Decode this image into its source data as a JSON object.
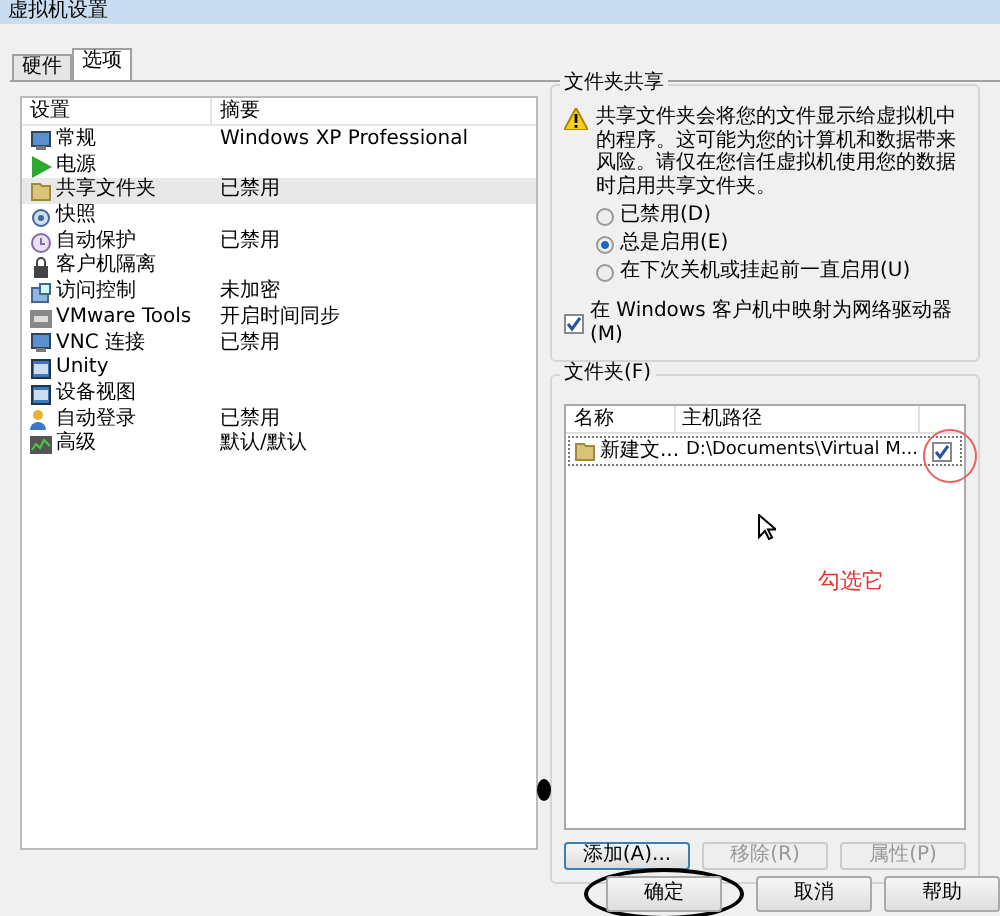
{
  "window": {
    "title": "虚拟机设置"
  },
  "tabs": [
    {
      "label": "硬件",
      "selected": false
    },
    {
      "label": "选项",
      "selected": true
    }
  ],
  "settings": {
    "columns": [
      "设置",
      "摘要"
    ],
    "rows": [
      {
        "name": "常规",
        "summary": "Windows XP Professional",
        "selected": false
      },
      {
        "name": "电源",
        "selected": false
      },
      {
        "name": "共享文件夹",
        "summary": "已禁用",
        "selected": true
      },
      {
        "name": "快照",
        "selected": false
      },
      {
        "name": "自动保护",
        "summary": "已禁用",
        "selected": false
      },
      {
        "name": "客户机隔离",
        "selected": false
      },
      {
        "name": "访问控制",
        "summary": "未加密",
        "selected": false
      },
      {
        "name": "VMware Tools",
        "summary": "开启时间同步",
        "selected": false
      },
      {
        "name": "VNC 连接",
        "summary": "已禁用",
        "selected": false
      },
      {
        "name": "Unity",
        "selected": false
      },
      {
        "name": "设备视图",
        "selected": false
      },
      {
        "name": "自动登录",
        "summary": "已禁用",
        "selected": false
      },
      {
        "name": "高级",
        "summary": "默认/默认",
        "selected": false
      }
    ]
  },
  "sharing": {
    "title": "文件夹共享",
    "warning": "共享文件夹会将您的文件显示给虚拟机中的程序。这可能为您的计算机和数据带来风险。请仅在您信任虚拟机使用您的数据时启用共享文件夹。",
    "options": [
      {
        "label": "已禁用(D)",
        "selected": false
      },
      {
        "label": "总是启用(E)",
        "selected": true
      },
      {
        "label": "在下次关机或挂起前一直启用(U)",
        "selected": false
      }
    ],
    "map_drive": {
      "label": "在 Windows 客户机中映射为网络驱动器(M)",
      "checked": true
    }
  },
  "folders": {
    "title": "文件夹(F)",
    "columns": [
      "名称",
      "主机路径"
    ],
    "rows": [
      {
        "name": "新建文...",
        "path": "D:\\Documents\\Virtual M...",
        "checked": true
      }
    ],
    "buttons": [
      {
        "label": "添加(A)...",
        "disabled": false
      },
      {
        "label": "移除(R)",
        "disabled": true
      },
      {
        "label": "属性(P)",
        "disabled": true
      }
    ]
  },
  "annotation": {
    "text": "勾选它"
  },
  "footer_buttons": [
    "确定",
    "取消",
    "帮助"
  ]
}
